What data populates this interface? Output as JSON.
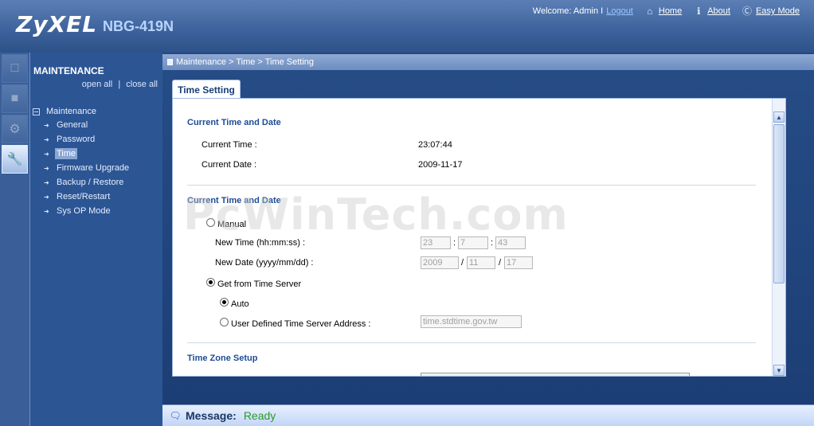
{
  "header": {
    "logo": "ZyXEL",
    "model": "NBG-419N",
    "welcome": "Welcome: Admin I",
    "logout": "Logout",
    "home": "Home",
    "about": "About",
    "easy_mode": "Easy Mode"
  },
  "menu": {
    "title": "MAINTENANCE",
    "open_all": "open all",
    "sep": "|",
    "close_all": "close all",
    "root": "Maintenance",
    "items": [
      {
        "label": "General",
        "selected": false
      },
      {
        "label": "Password",
        "selected": false
      },
      {
        "label": "Time",
        "selected": true
      },
      {
        "label": "Firmware Upgrade",
        "selected": false
      },
      {
        "label": "Backup / Restore",
        "selected": false
      },
      {
        "label": "Reset/Restart",
        "selected": false
      },
      {
        "label": "Sys OP Mode",
        "selected": false
      }
    ]
  },
  "breadcrumb": "Maintenance > Time > Time Setting",
  "tab": "Time Setting",
  "current": {
    "section": "Current Time and Date",
    "time_label": "Current Time :",
    "time_value": "23:07:44",
    "date_label": "Current Date :",
    "date_value": "2009-11-17"
  },
  "setting": {
    "section": "Current Time and Date",
    "manual": "Manual",
    "new_time_label": "New Time (hh:mm:ss) :",
    "hh": "23",
    "mm": "7",
    "ss": "43",
    "time_sep": ":",
    "new_date_label": "New Date (yyyy/mm/dd) :",
    "yyyy": "2009",
    "month": "11",
    "day": "17",
    "date_sep": "/",
    "server": "Get from Time Server",
    "auto": "Auto",
    "user_defined": "User Defined Time Server Address :",
    "server_address": "time.stdtime.gov.tw",
    "selected_mode": "Get from Time Server",
    "selected_server": "Auto"
  },
  "timezone": {
    "section": "Time Zone Setup"
  },
  "watermark": "PcWinTech.com",
  "message": {
    "label": "Message:",
    "value": "Ready"
  },
  "colors": {
    "accent": "#1d4c95",
    "status_ok": "#2b9a2b"
  }
}
